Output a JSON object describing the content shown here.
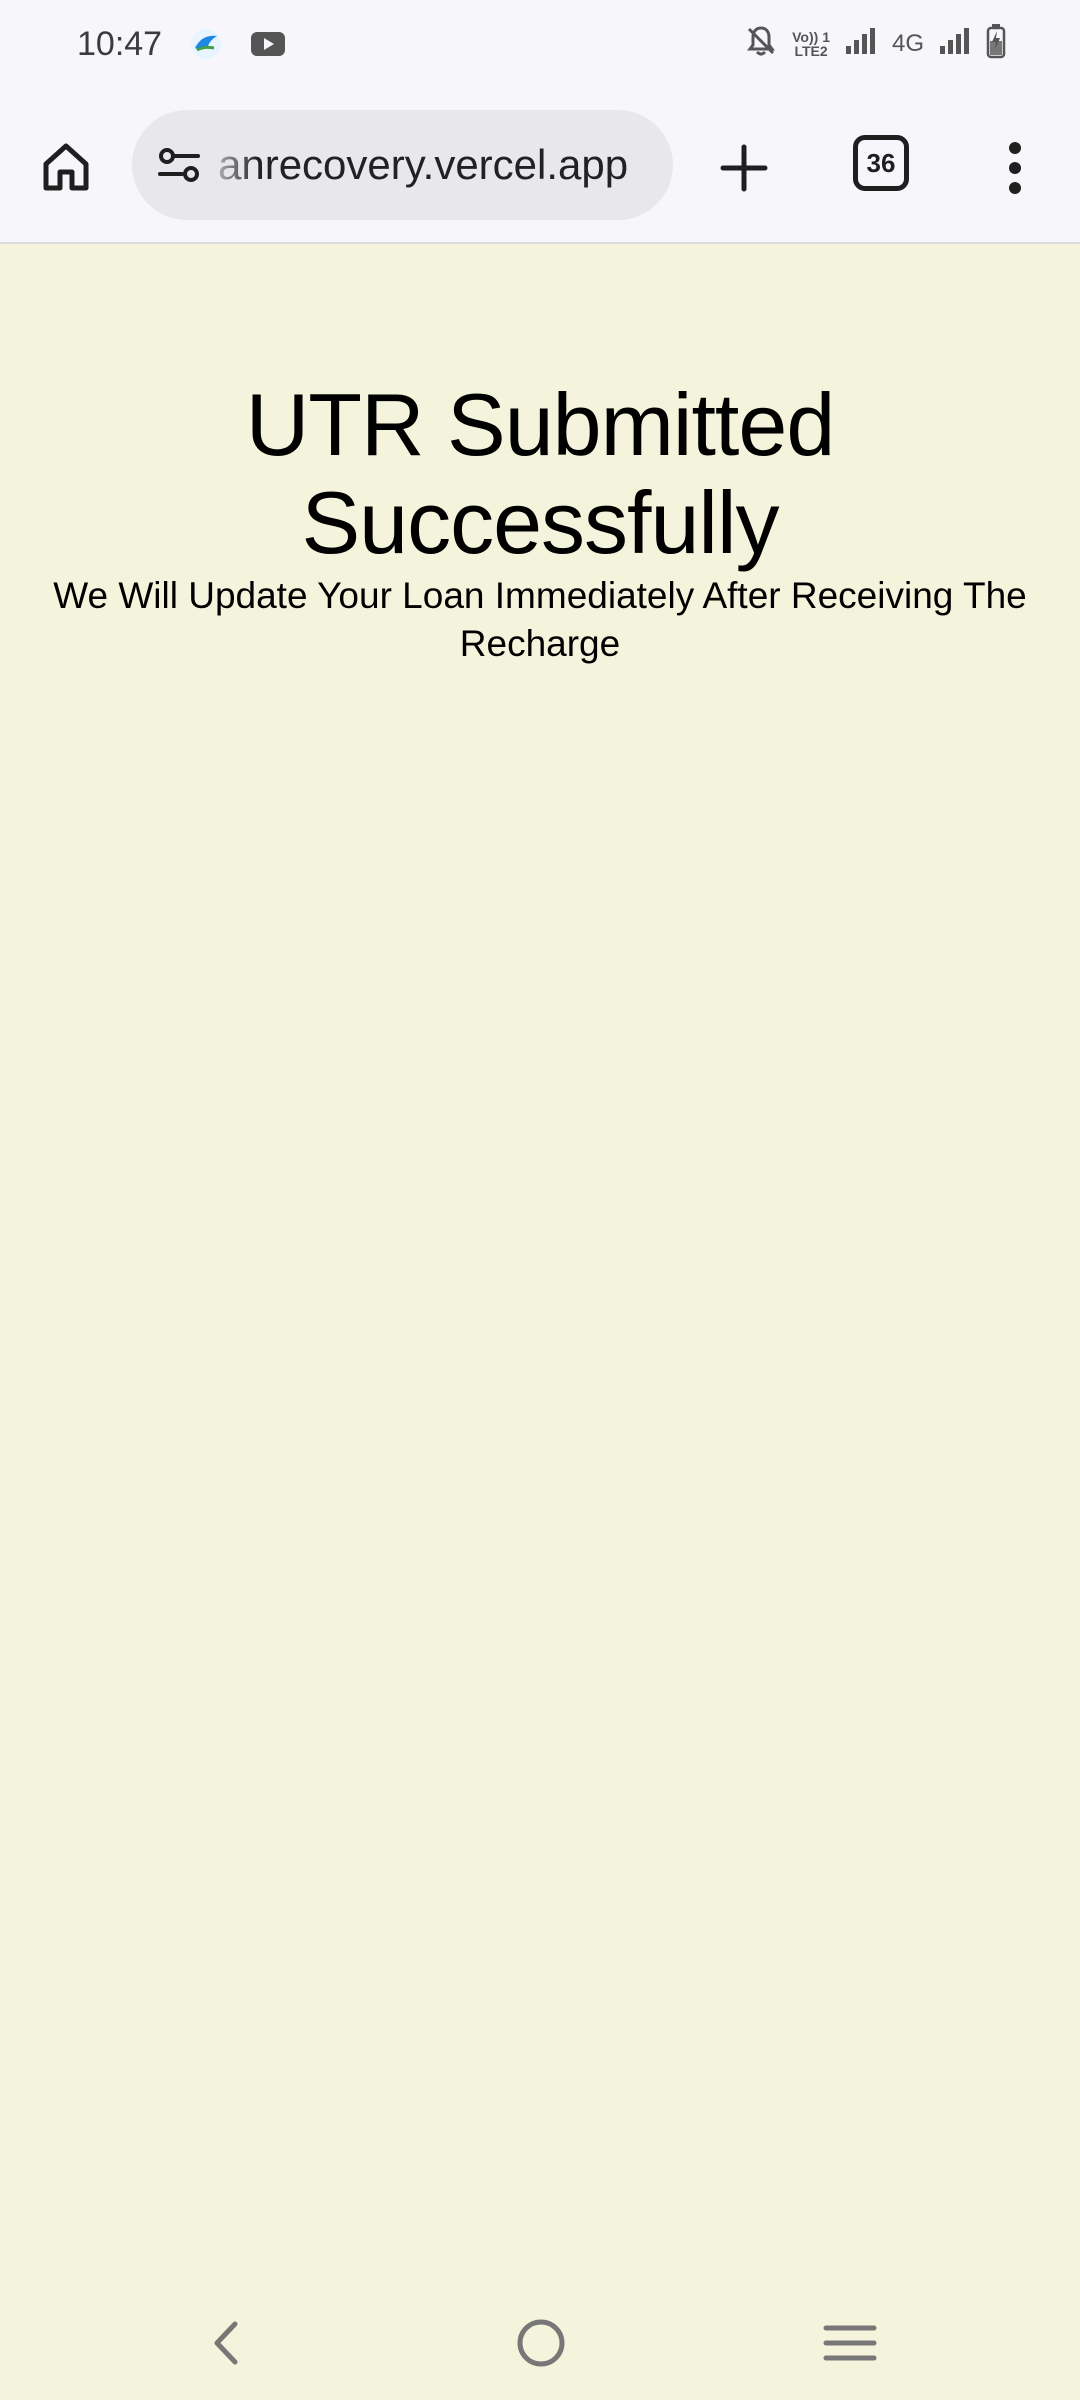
{
  "status_bar": {
    "time": "10:47",
    "app_icons": [
      "bird-app-icon",
      "youtube-icon"
    ],
    "right_icons": [
      "notifications-muted-icon",
      "volte-icon",
      "signal-icon",
      "network-type",
      "signal-icon-2",
      "battery-charging-icon"
    ],
    "lte_line1": "Vo)) 1",
    "lte_line2": "LTE2",
    "network_type": "4G"
  },
  "toolbar": {
    "url": "anrecovery.vercel.app",
    "tab_count": "36"
  },
  "page": {
    "title": "UTR Submitted Successfully",
    "subtitle": "We Will Update Your Loan Immediately After Receiving The Recharge",
    "background_color": "#f4f4dc"
  },
  "nav_bar": {
    "buttons": [
      "back-icon",
      "home-icon",
      "recents-icon"
    ]
  }
}
